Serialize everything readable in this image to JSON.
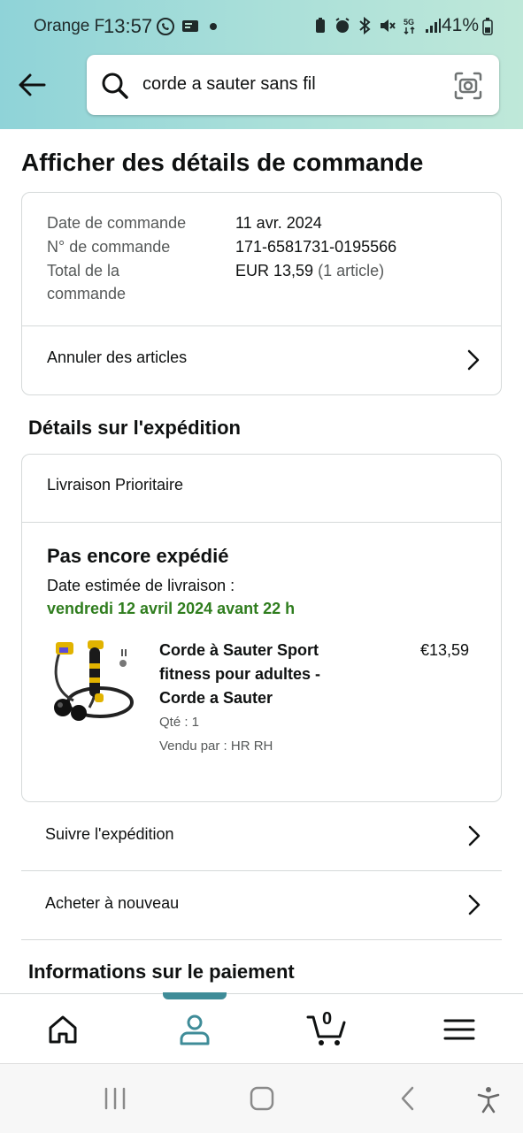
{
  "status_bar": {
    "carrier": "Orange F",
    "time": "13:57",
    "battery": "41%"
  },
  "search": {
    "query": "corde a sauter sans fil"
  },
  "page": {
    "title": "Afficher des détails de commande"
  },
  "order_summary": {
    "date_label": "Date de commande",
    "date_value": "11 avr. 2024",
    "number_label": "N° de commande",
    "number_value": "171-6581731-0195566",
    "total_label_line1": "Total de la",
    "total_label_line2": "commande",
    "total_value": "EUR 13,59",
    "total_count": "(1 article)",
    "cancel_label": "Annuler des articles"
  },
  "shipment": {
    "section_title": "Détails sur l'expédition",
    "delivery_type": "Livraison Prioritaire",
    "status": "Pas encore expédié",
    "estimate_label": "Date estimée de livraison :",
    "estimate_date": "vendredi 12 avril 2024 avant 22 h",
    "product": {
      "title_line1": "Corde à Sauter Sport",
      "title_line2": "fitness pour adultes -",
      "title_line3": "Corde a Sauter",
      "price": "€13,59",
      "quantity": "Qté : 1",
      "seller": "Vendu par : HR RH"
    }
  },
  "actions": {
    "track": "Suivre l'expédition",
    "buy_again": "Acheter à nouveau"
  },
  "payment": {
    "section_title": "Informations sur le paiement"
  },
  "bottom_nav": {
    "cart_count": "0",
    "active": "account"
  },
  "colors": {
    "accent": "#3f8c98",
    "delivery_green": "#2f7d1e"
  }
}
